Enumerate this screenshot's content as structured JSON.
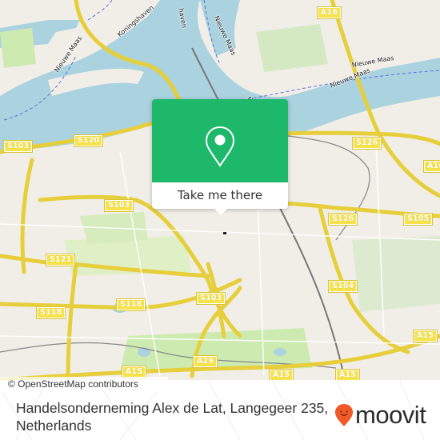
{
  "map": {
    "colors": {
      "land": "#f1eee8",
      "water": "#aad3df",
      "park": "#cdebb0",
      "motorway": "#f6e24b",
      "rail": "#777777",
      "ferry": "#5b6ee1"
    },
    "road_shields": [
      {
        "id": "a16-top",
        "label": "A16"
      },
      {
        "id": "s103-nw",
        "label": "S103"
      },
      {
        "id": "s120",
        "label": "S120"
      },
      {
        "id": "s126-north",
        "label": "S126"
      },
      {
        "id": "a16-east",
        "label": "A16"
      },
      {
        "id": "s103-mid",
        "label": "S103"
      },
      {
        "id": "s126-mid",
        "label": "S126"
      },
      {
        "id": "s105",
        "label": "S105"
      },
      {
        "id": "s121",
        "label": "S121"
      },
      {
        "id": "s104",
        "label": "S104"
      },
      {
        "id": "s118-east",
        "label": "S118"
      },
      {
        "id": "s103-south",
        "label": "S103"
      },
      {
        "id": "s118-west",
        "label": "S118"
      },
      {
        "id": "a15-east",
        "label": "A15"
      },
      {
        "id": "a29",
        "label": "A29"
      },
      {
        "id": "a15-west",
        "label": "A15"
      },
      {
        "id": "a15-mid",
        "label": "A15"
      },
      {
        "id": "a15-southeast",
        "label": "A15"
      }
    ],
    "water_labels": [
      {
        "id": "nieuwe-maas-west",
        "label": "Nieuwe Maas"
      },
      {
        "id": "nieuwe-maas-north",
        "label": "Nieuwe Maas"
      },
      {
        "id": "nieuwe-maas-east-1",
        "label": "Nieuwe Maas"
      },
      {
        "id": "nieuwe-maas-east-2",
        "label": "Nieuwe Maas"
      },
      {
        "id": "nieuwe-maas-center",
        "label": "Nieu"
      }
    ],
    "street_labels": [
      {
        "id": "koningshaven",
        "label": "Koningshaven"
      },
      {
        "id": "spoorweghaven",
        "label": "haven"
      }
    ],
    "attribution": "© OpenStreetMap contributors"
  },
  "popup": {
    "icon": "location-pin-icon",
    "cta_label": "Take me there"
  },
  "footer": {
    "address": "Handelsonderneming Alex de Lat, Langegeer 235, Netherlands",
    "brand": "moovit",
    "brand_color": "#f05a28"
  }
}
